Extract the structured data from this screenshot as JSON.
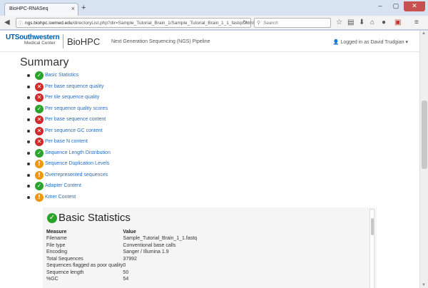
{
  "browser": {
    "tab_title": "BioHPC-RNASeq",
    "url_host": "ngs.biohpc.swmed.edu",
    "url_path": "/directoryList.php?dir=Sample_Tutorial_Brain_1/Sample_Tutorial_Brain_1_1_fastqc.html",
    "search_placeholder": "Search"
  },
  "header": {
    "logo_ut": "UTSouthwestern",
    "logo_mc": "Medical Center",
    "brand": "BioHPC",
    "pipeline": "Next Generation Sequencing (NGS) Pipeline",
    "user": "Logged in as  David Trudgian"
  },
  "summary": {
    "title": "Summary",
    "modules": [
      {
        "label": "Basic Statistics",
        "status": "pass"
      },
      {
        "label": "Per base sequence quality",
        "status": "fail"
      },
      {
        "label": "Per tile sequence quality",
        "status": "fail"
      },
      {
        "label": "Per sequence quality scores",
        "status": "pass"
      },
      {
        "label": "Per base sequence content",
        "status": "fail"
      },
      {
        "label": "Per sequence GC content",
        "status": "fail"
      },
      {
        "label": "Per base N content",
        "status": "fail"
      },
      {
        "label": "Sequence Length Distribution",
        "status": "pass"
      },
      {
        "label": "Sequence Duplication Levels",
        "status": "warn"
      },
      {
        "label": "Overrepresented sequences",
        "status": "warn"
      },
      {
        "label": "Adapter Content",
        "status": "pass"
      },
      {
        "label": "Kmer Content",
        "status": "warn"
      }
    ]
  },
  "basic_stats": {
    "title": "Basic Statistics",
    "headers": [
      "Measure",
      "Value"
    ],
    "rows": [
      [
        "Filename",
        "Sample_Tutorial_Brain_1_1.fastq"
      ],
      [
        "File type",
        "Conventional base calls"
      ],
      [
        "Encoding",
        "Sanger / Illumina 1.9"
      ],
      [
        "Total Sequences",
        "37992"
      ],
      [
        "Sequences flagged as poor quality",
        "0"
      ],
      [
        "Sequence length",
        "50"
      ],
      [
        "%GC",
        "54"
      ]
    ]
  },
  "colors": {
    "pass": "#2aa32a",
    "fail": "#d12a2a",
    "warn": "#f0960f",
    "link": "#2a6ebb"
  }
}
